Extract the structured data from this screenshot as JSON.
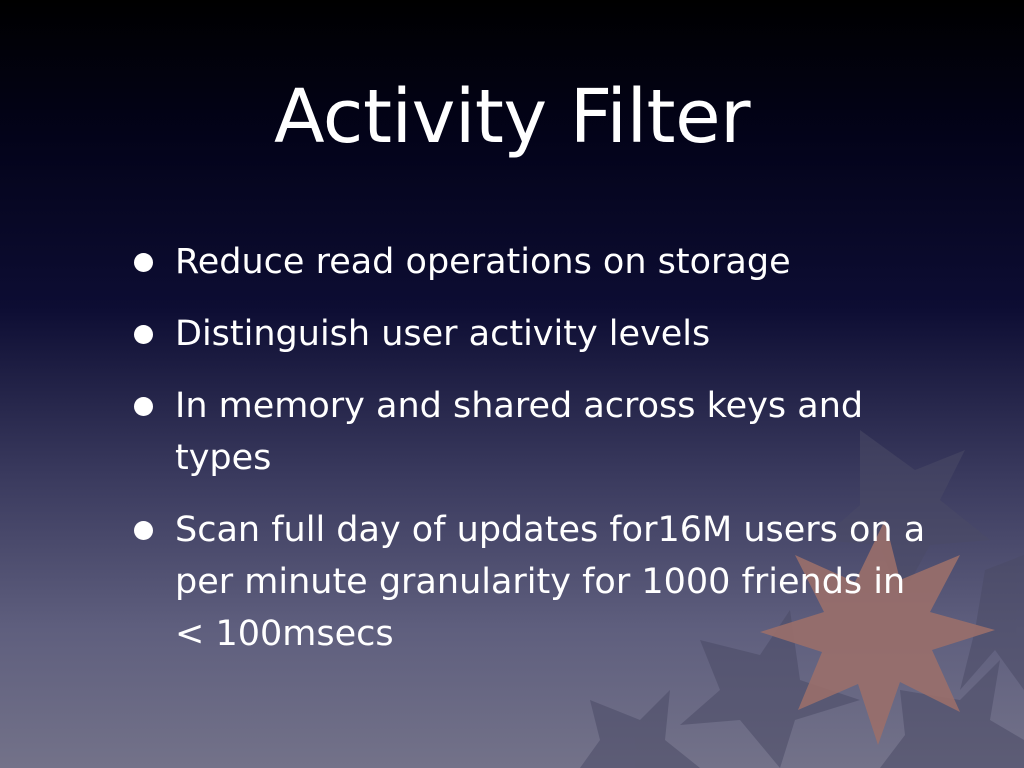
{
  "slide": {
    "title": "Activity Filter",
    "bullets": [
      {
        "text": "Reduce read operations on storage"
      },
      {
        "text": "Distinguish user activity levels"
      },
      {
        "text": "In memory and shared across keys and types"
      },
      {
        "text": "Scan full day of updates for16M users on a per minute granularity for 1000 friends in < 100msecs"
      }
    ]
  },
  "colors": {
    "star_accent": "#9a6f6a",
    "star_dark": "#4f4f6a"
  }
}
